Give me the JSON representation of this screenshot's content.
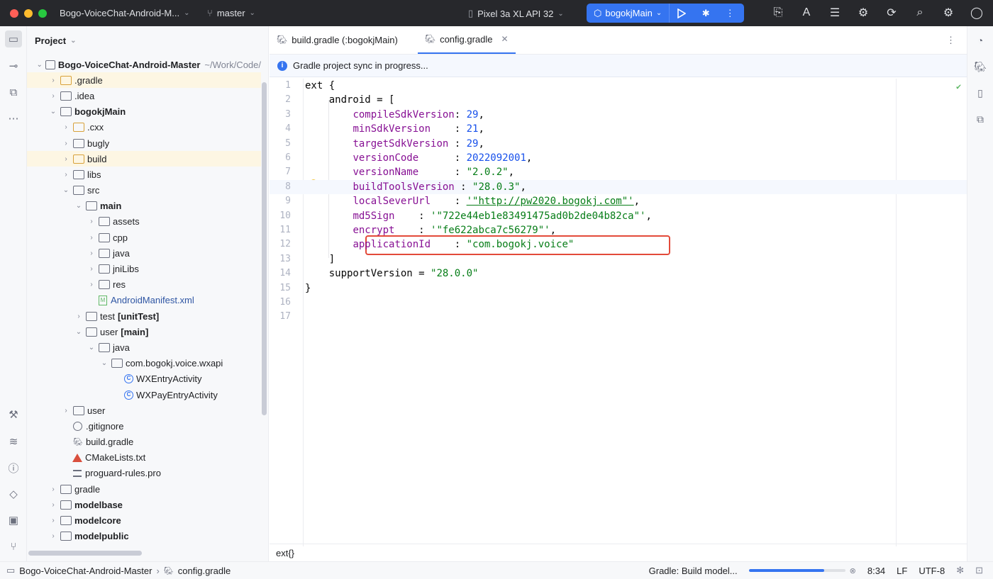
{
  "titlebar": {
    "project": "Bogo-VoiceChat-Android-M...",
    "branch": "master",
    "device": "Pixel 3a XL API 32",
    "run_config": "bogokjMain"
  },
  "project_panel": {
    "title": "Project",
    "root": "Bogo-VoiceChat-Android-Master",
    "root_path": "~/Work/Code/",
    "tree": [
      {
        "label": ".gradle",
        "depth": 1,
        "arrow": "›",
        "icon": "folder-yellow",
        "hl": true
      },
      {
        "label": ".idea",
        "depth": 1,
        "arrow": "›",
        "icon": "folder"
      },
      {
        "label": "bogokjMain",
        "depth": 1,
        "arrow": "⌄",
        "icon": "folder",
        "bold": true
      },
      {
        "label": ".cxx",
        "depth": 2,
        "arrow": "›",
        "icon": "folder-yellow"
      },
      {
        "label": "bugly",
        "depth": 2,
        "arrow": "›",
        "icon": "folder"
      },
      {
        "label": "build",
        "depth": 2,
        "arrow": "›",
        "icon": "folder-yellow",
        "hl": true
      },
      {
        "label": "libs",
        "depth": 2,
        "arrow": "›",
        "icon": "folder"
      },
      {
        "label": "src",
        "depth": 2,
        "arrow": "⌄",
        "icon": "folder"
      },
      {
        "label": "main",
        "depth": 3,
        "arrow": "⌄",
        "icon": "folder",
        "bold": true
      },
      {
        "label": "assets",
        "depth": 4,
        "arrow": "›",
        "icon": "folder"
      },
      {
        "label": "cpp",
        "depth": 4,
        "arrow": "›",
        "icon": "folder"
      },
      {
        "label": "java",
        "depth": 4,
        "arrow": "›",
        "icon": "folder"
      },
      {
        "label": "jniLibs",
        "depth": 4,
        "arrow": "›",
        "icon": "folder"
      },
      {
        "label": "res",
        "depth": 4,
        "arrow": "›",
        "icon": "folder"
      },
      {
        "label": "AndroidManifest.xml",
        "depth": 4,
        "arrow": "",
        "icon": "xml",
        "blue": true
      },
      {
        "label": "test",
        "suffix": "[unitTest]",
        "depth": 3,
        "arrow": "›",
        "icon": "folder"
      },
      {
        "label": "user",
        "suffix": "[main]",
        "depth": 3,
        "arrow": "⌄",
        "icon": "folder"
      },
      {
        "label": "java",
        "depth": 4,
        "arrow": "⌄",
        "icon": "folder"
      },
      {
        "label": "com.bogokj.voice.wxapi",
        "depth": 5,
        "arrow": "⌄",
        "icon": "folder"
      },
      {
        "label": "WXEntryActivity",
        "depth": 6,
        "arrow": "",
        "icon": "class"
      },
      {
        "label": "WXPayEntryActivity",
        "depth": 6,
        "arrow": "",
        "icon": "class"
      },
      {
        "label": "user",
        "depth": 2,
        "arrow": "›",
        "icon": "folder"
      },
      {
        "label": ".gitignore",
        "depth": 2,
        "arrow": "",
        "icon": "ignore"
      },
      {
        "label": "build.gradle",
        "depth": 2,
        "arrow": "",
        "icon": "gradle"
      },
      {
        "label": "CMakeLists.txt",
        "depth": 2,
        "arrow": "",
        "icon": "cmake"
      },
      {
        "label": "proguard-rules.pro",
        "depth": 2,
        "arrow": "",
        "icon": "lines"
      },
      {
        "label": "gradle",
        "depth": 1,
        "arrow": "›",
        "icon": "folder"
      },
      {
        "label": "modelbase",
        "depth": 1,
        "arrow": "›",
        "icon": "folder",
        "bold": true
      },
      {
        "label": "modelcore",
        "depth": 1,
        "arrow": "›",
        "icon": "folder",
        "bold": true
      },
      {
        "label": "modelpublic",
        "depth": 1,
        "arrow": "›",
        "icon": "folder",
        "bold": true
      }
    ]
  },
  "editor": {
    "tabs": [
      {
        "label": "build.gradle (:bogokjMain)",
        "active": false
      },
      {
        "label": "config.gradle",
        "active": true
      }
    ],
    "banner": "Gradle project sync in progress...",
    "breadcrumb": "ext{}",
    "code": [
      {
        "n": "1",
        "t": "ext {"
      },
      {
        "n": "2",
        "t": "    android = ["
      },
      {
        "n": "3",
        "k": "compileSdkVersion",
        "p": ": ",
        "v": "29",
        "vt": "num",
        "e": ","
      },
      {
        "n": "4",
        "k": "minSdkVersion    ",
        "p": ": ",
        "v": "21",
        "vt": "num",
        "e": ","
      },
      {
        "n": "5",
        "k": "targetSdkVersion ",
        "p": ": ",
        "v": "29",
        "vt": "num",
        "e": ","
      },
      {
        "n": "6",
        "k": "versionCode      ",
        "p": ": ",
        "v": "2022092001",
        "vt": "num",
        "e": ","
      },
      {
        "n": "7",
        "k": "versionName      ",
        "p": ": ",
        "v": "\"2.0.2\"",
        "vt": "str",
        "e": ","
      },
      {
        "n": "8",
        "k": "buildToolsVersion",
        "p": " : ",
        "v": "\"28.0.3\"",
        "vt": "str",
        "e": ","
      },
      {
        "n": "9",
        "k": "localSeverUrl    ",
        "p": ": ",
        "v": "'\"http://pw2020.bogokj.com\"'",
        "vt": "url",
        "e": ","
      },
      {
        "n": "10",
        "k": "md5Sign    ",
        "p": ": ",
        "v": "'\"722e44eb1e83491475ad0b2de04b82ca\"'",
        "vt": "str",
        "e": ","
      },
      {
        "n": "11",
        "k": "encrypt    ",
        "p": ": ",
        "v": "'\"fe622abca7c56279\"'",
        "vt": "str",
        "e": ","
      },
      {
        "n": "12",
        "k": "applicationId    ",
        "p": ": ",
        "v": "\"com.bogokj.voice\"",
        "vt": "str",
        "e": ""
      },
      {
        "n": "13",
        "t": "    ]"
      },
      {
        "n": "14",
        "t": "    supportVersion = ",
        "v": "\"28.0.0\"",
        "vt": "str"
      },
      {
        "n": "15",
        "t": "}"
      },
      {
        "n": "16",
        "t": ""
      },
      {
        "n": "17",
        "t": ""
      }
    ]
  },
  "status": {
    "path_root": "Bogo-VoiceChat-Android-Master",
    "path_file": "config.gradle",
    "task": "Gradle: Build model...",
    "progress": 0.78,
    "position": "8:34",
    "line_sep": "LF",
    "encoding": "UTF-8"
  },
  "colors": {
    "accent": "#3574f0",
    "highlight_box": "#e34a3a",
    "titlebar_bg": "#27282c"
  }
}
